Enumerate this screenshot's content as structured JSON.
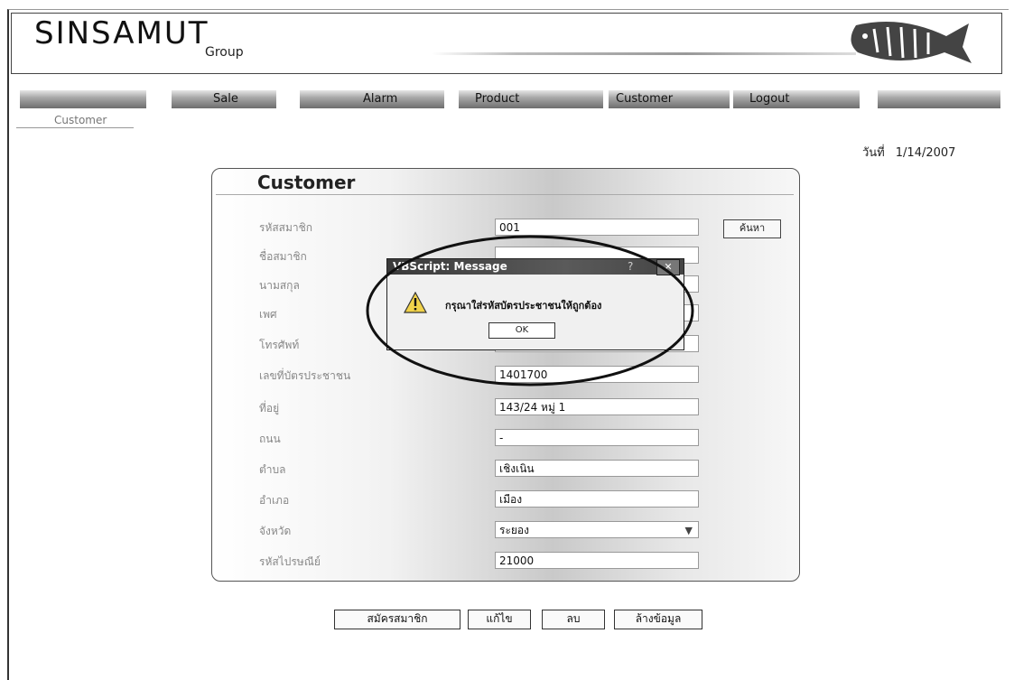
{
  "brand": {
    "name": "SINSAMUT",
    "sub": "Group"
  },
  "nav": {
    "items": [
      {
        "label": "Sale"
      },
      {
        "label": "Alarm"
      },
      {
        "label": "Product"
      },
      {
        "label": "Customer"
      },
      {
        "label": "Logout"
      }
    ]
  },
  "breadcrumb": "Customer",
  "date": {
    "label": "วันที่",
    "value": "1/14/2007"
  },
  "panel": {
    "title": "Customer",
    "search_label": "ค้นหา",
    "fields": [
      {
        "label": "รหัสสมาชิก",
        "value": "001"
      },
      {
        "label": "ชื่อสมาชิก",
        "value": ""
      },
      {
        "label": "นามสกุล",
        "value": ""
      },
      {
        "label": "เพศ",
        "value": ""
      },
      {
        "label": "โทรศัพท์",
        "value": ""
      },
      {
        "label": "เลขที่บัตรประชาชน",
        "value": "1401700"
      },
      {
        "label": "ที่อยู่",
        "value": "143/24 หมู่ 1"
      },
      {
        "label": "ถนน",
        "value": "-"
      },
      {
        "label": "ตำบล",
        "value": "เชิงเนิน"
      },
      {
        "label": "อำเภอ",
        "value": "เมือง"
      },
      {
        "label": "จังหวัด",
        "value": "ระยอง"
      },
      {
        "label": "รหัสไปรษณีย์",
        "value": "21000"
      }
    ]
  },
  "buttons": {
    "register": "สมัครสมาชิก",
    "edit": "แก้ไข",
    "delete": "ลบ",
    "clear": "ล้างข้อมูล"
  },
  "dialog": {
    "title": "VBScript: Message",
    "help": "?",
    "close": "✕",
    "message": "กรุณาใส่รหัสบัตรประชาชนให้ถูกต้อง",
    "ok": "OK"
  },
  "colors": {
    "nav_bar": "#8a8a8a",
    "dialog_title": "#3a3a3a",
    "highlight_ellipse": "#111111"
  }
}
